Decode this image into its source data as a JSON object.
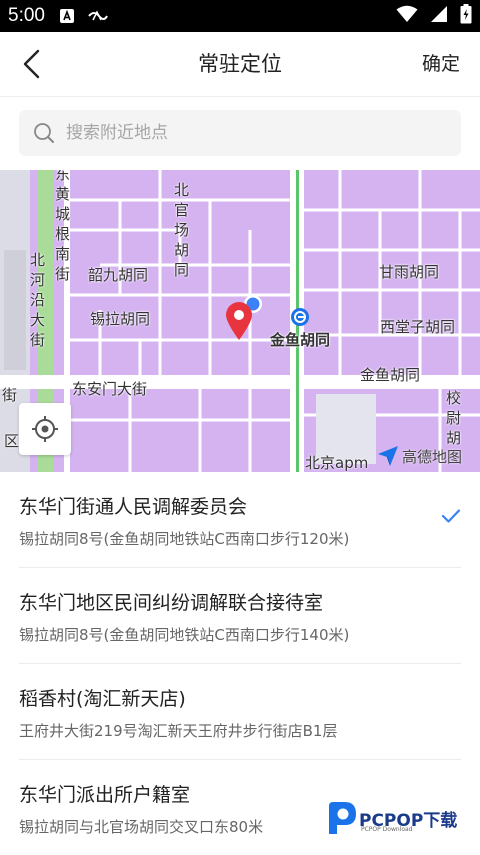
{
  "status_bar": {
    "time": "5:00"
  },
  "header": {
    "title": "常驻定位",
    "confirm_label": "确定"
  },
  "search": {
    "placeholder": "搜索附近地点"
  },
  "map": {
    "labels": {
      "dongcheng": "东黄城根南街",
      "beiguanchang": "北官场胡同",
      "beiheyan": "北河沿大街",
      "shaojiu": "韶九胡同",
      "ganyu": "甘雨胡同",
      "xila": "锡拉胡同",
      "jinyu_metro": "金鱼胡同",
      "xitangzi": "西堂子胡同",
      "dongan": "东安门大街",
      "jinyu_street": "金鱼胡同",
      "xiaowei": "校尉胡",
      "beijing_apm": "北京apm",
      "left_edge_jie": "街",
      "left_edge_qu": "区",
      "amap_brand": "高德地图"
    },
    "colors": {
      "background": "#d4b3f0",
      "road": "#ffffff",
      "park": "#9ed88f",
      "pin": "#e8343f",
      "location_dot": "#3b82f6"
    }
  },
  "places": [
    {
      "name": "东华门街通人民调解委员会",
      "address": "锡拉胡同8号(金鱼胡同地铁站C西南口步行120米)",
      "selected": true
    },
    {
      "name": "东华门地区民间纠纷调解联合接待室",
      "address": "锡拉胡同8号(金鱼胡同地铁站C西南口步行140米)",
      "selected": false
    },
    {
      "name": "稻香村(淘汇新天店)",
      "address": "王府井大街219号淘汇新天王府井步行街店B1层",
      "selected": false
    },
    {
      "name": "东华门派出所户籍室",
      "address": "锡拉胡同与北官场胡同交叉口东80米",
      "selected": false
    }
  ],
  "watermark": {
    "brand": "PCPOP下载",
    "sub": "PCPOP Download"
  },
  "icons": {
    "back": "chevron-left-icon",
    "search": "search-icon",
    "locate": "crosshair-icon",
    "check": "check-icon",
    "pin": "map-pin-icon"
  }
}
